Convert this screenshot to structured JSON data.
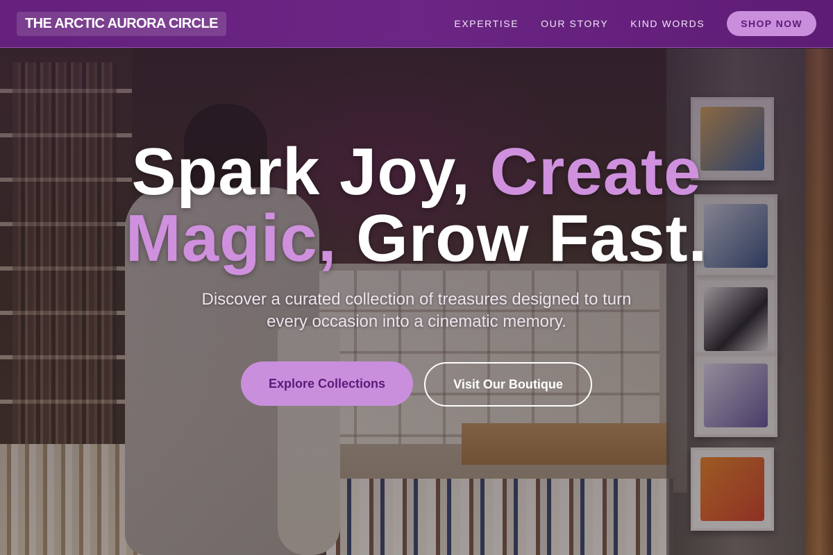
{
  "nav": {
    "logo": "THE ARCTIC AURORA CIRCLE",
    "links": [
      "EXPERTISE",
      "OUR STORY",
      "KIND WORDS"
    ],
    "shop_button": "SHOP NOW"
  },
  "hero": {
    "headline_part1": "Spark Joy, ",
    "headline_accent1": "Create",
    "headline_accent2": "Magic,",
    "headline_part2": " Grow Fast.",
    "subtitle": "Discover a curated collection of treasures designed to turn every occasion into a cinematic memory.",
    "primary_cta": "Explore Collections",
    "secondary_cta": "Visit Our Boutique"
  },
  "colors": {
    "nav_bg": "#6e2488",
    "accent": "#cf90de",
    "button_fill": "#c98fdc",
    "button_text": "#5a1b7a"
  },
  "background": {
    "description_icon": "shop-photo"
  }
}
